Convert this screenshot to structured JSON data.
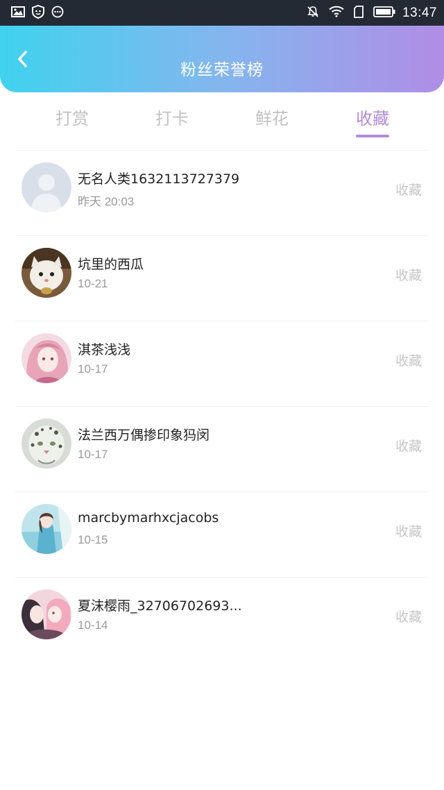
{
  "status_bar": {
    "time": "13:47",
    "left_icons": [
      "image-icon",
      "shield-icon",
      "more-icon"
    ],
    "right_icons": [
      "mute-icon",
      "wifi-icon",
      "sim-icon",
      "battery-icon"
    ]
  },
  "header": {
    "title": "粉丝荣誉榜",
    "back_icon": "chevron-left-icon",
    "gradient": [
      "#3fd2ee",
      "#84b6ee",
      "#b08de6"
    ]
  },
  "tabs": [
    {
      "label": "打赏",
      "active": false
    },
    {
      "label": "打卡",
      "active": false
    },
    {
      "label": "鲜花",
      "active": false
    },
    {
      "label": "收藏",
      "active": true
    }
  ],
  "accent_color": "#b38ad8",
  "fans": [
    {
      "name": "无名人类1632113727379",
      "time": "昨天 20:03",
      "action": "收藏",
      "avatar": "default-avatar"
    },
    {
      "name": "坑里的西瓜",
      "time": "10-21",
      "action": "收藏",
      "avatar": "cat-avatar"
    },
    {
      "name": "淇茶浅浅",
      "time": "10-17",
      "action": "收藏",
      "avatar": "anime-girl-pink-avatar"
    },
    {
      "name": "法兰西万偶掺印象犸闵",
      "time": "10-17",
      "action": "收藏",
      "avatar": "snow-leopard-avatar"
    },
    {
      "name": "marcbymarhxcjacobs",
      "time": "10-15",
      "action": "收藏",
      "avatar": "anime-girl-blue-avatar"
    },
    {
      "name": "夏沫樱雨_32706702693...",
      "time": "10-14",
      "action": "收藏",
      "avatar": "anime-couple-avatar"
    }
  ]
}
